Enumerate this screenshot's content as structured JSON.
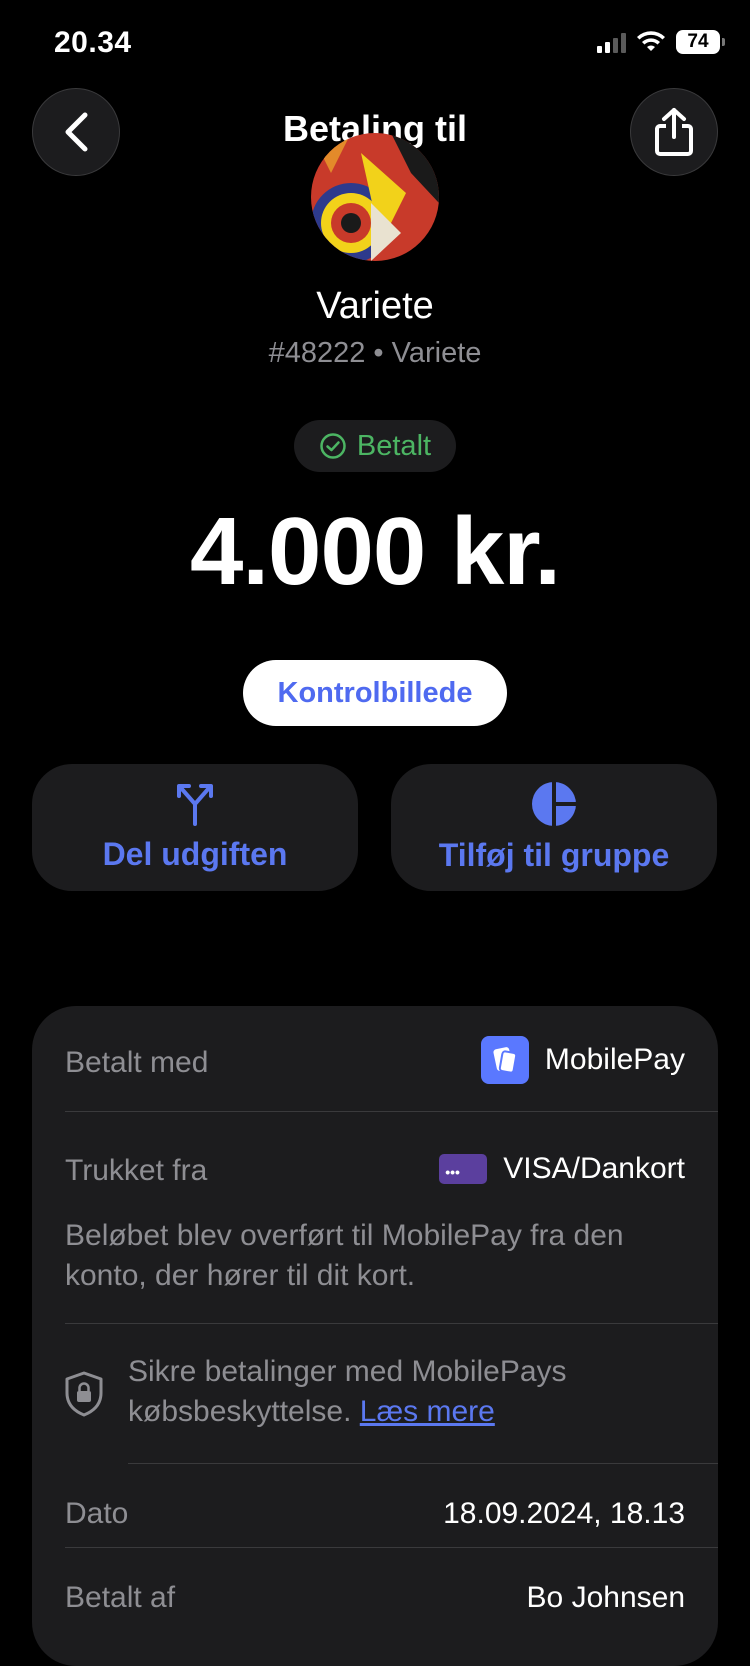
{
  "status_bar": {
    "time": "20.34",
    "battery": "74"
  },
  "header": {
    "title": "Betaling til"
  },
  "merchant": {
    "name": "Variete",
    "subtitle": "#48222 • Variete"
  },
  "payment": {
    "status": "Betalt",
    "status_color": "#4cb563",
    "amount": "4.000 kr."
  },
  "buttons": {
    "kontrol": "Kontrolbillede",
    "split": "Del udgiften",
    "add_group": "Tilføj til gruppe"
  },
  "details": {
    "paid_with_label": "Betalt med",
    "paid_with_value": "MobilePay",
    "drawn_from_label": "Trukket fra",
    "drawn_from_value": "VISA/Dankort",
    "card_chip_text": "•••",
    "transfer_note": "Beløbet blev overført til MobilePay fra den konto, der hører til dit kort.",
    "protection_text": "Sikre betalinger med MobilePays købsbeskyttelse.",
    "protection_link": "Læs mere",
    "date_label": "Dato",
    "date_value": "18.09.2024, 18.13",
    "paid_by_label": "Betalt af",
    "paid_by_value": "Bo Johnsen"
  },
  "colors": {
    "accent": "#5b78f0",
    "background": "#000000",
    "card": "#1c1c1e"
  }
}
